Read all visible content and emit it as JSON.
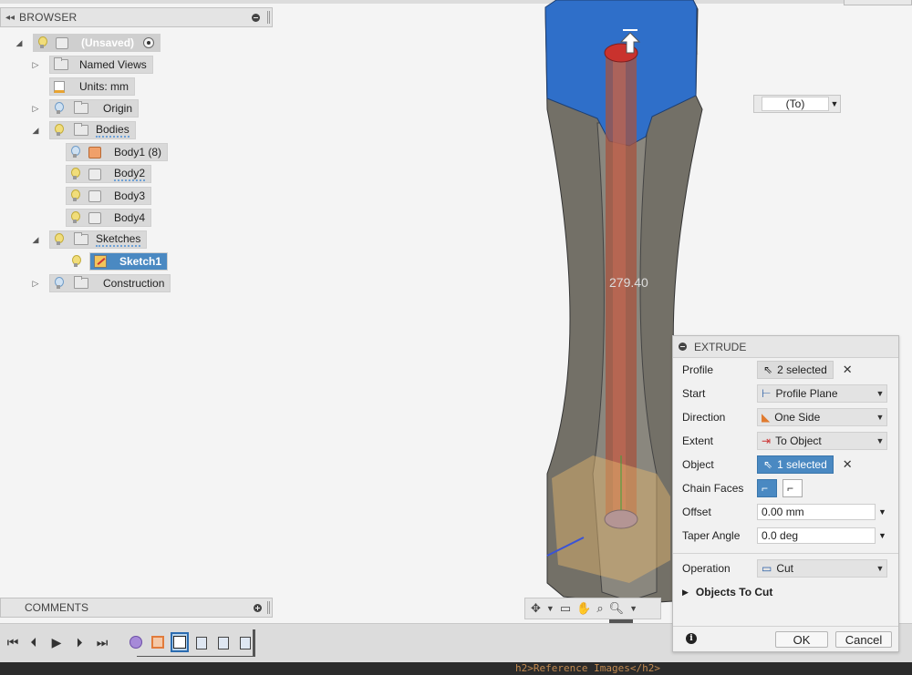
{
  "browser": {
    "title": "BROWSER",
    "root_label": "(Unsaved)",
    "items": {
      "named_views": "Named Views",
      "units": "Units: mm",
      "origin": "Origin",
      "bodies": "Bodies",
      "body1": "Body1 (8)",
      "body2": "Body2",
      "body3": "Body3",
      "body4": "Body4",
      "sketches": "Sketches",
      "sketch1": "Sketch1",
      "construction": "Construction"
    }
  },
  "comments": {
    "title": "COMMENTS"
  },
  "viewport": {
    "dimension": "279.40",
    "extent_value": "(To)"
  },
  "extrude": {
    "title": "EXTRUDE",
    "rows": {
      "profile": {
        "label": "Profile",
        "value": "2 selected"
      },
      "start": {
        "label": "Start",
        "value": "Profile Plane"
      },
      "direction": {
        "label": "Direction",
        "value": "One Side"
      },
      "extent": {
        "label": "Extent",
        "value": "To Object"
      },
      "object": {
        "label": "Object",
        "value": "1 selected"
      },
      "chain_faces": {
        "label": "Chain Faces"
      },
      "offset": {
        "label": "Offset",
        "value": "0.00 mm"
      },
      "taper": {
        "label": "Taper Angle",
        "value": "0.0 deg"
      },
      "operation": {
        "label": "Operation",
        "value": "Cut"
      },
      "objects_to_cut": {
        "label": "Objects To Cut"
      }
    },
    "ok": "OK",
    "cancel": "Cancel"
  },
  "bottom_text": "h2>Reference Images</h2>",
  "colors": {
    "accent": "#4a89c2",
    "body_cap": "#2f6fc9",
    "body_side": "#7a7670"
  }
}
